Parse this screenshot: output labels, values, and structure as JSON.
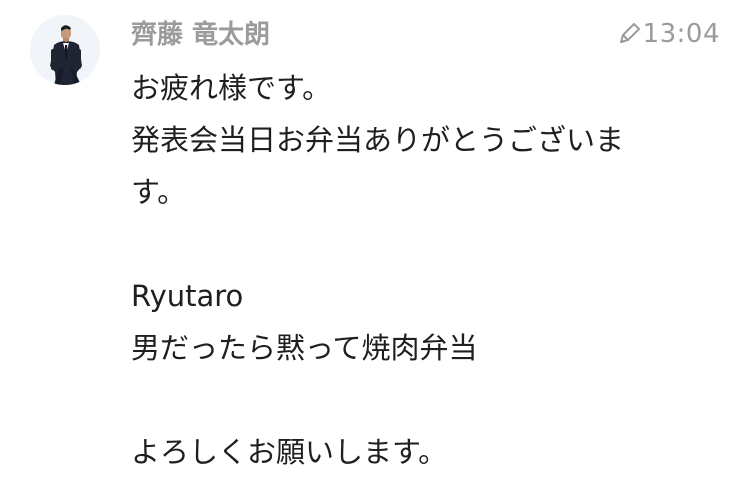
{
  "message": {
    "sender": "齊藤 竜太朗",
    "timestamp": "13:04",
    "edited_icon": "pencil-icon",
    "avatar_icon": "user-avatar-man-in-suit",
    "lines": [
      "お疲れ様です。",
      "発表会当日お弁当ありがとうございま",
      "す。",
      "",
      "Ryutaro",
      "男だったら黙って焼肉弁当",
      "",
      "よろしくお願いします。"
    ]
  },
  "colors": {
    "name": "#9b9b9b",
    "time": "#9b9b9b",
    "text": "#1f1f1f",
    "avatar_bg": "#eef3f8"
  }
}
